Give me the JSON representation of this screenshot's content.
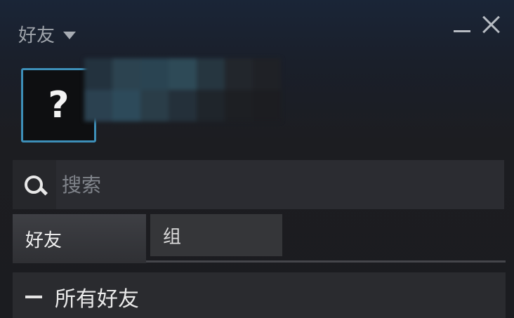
{
  "window": {
    "title": "好友",
    "controls": {
      "minimize": "minimize-icon",
      "close": "close-icon"
    }
  },
  "profile": {
    "avatar_glyph": "?"
  },
  "search": {
    "placeholder": "搜索",
    "value": ""
  },
  "tabs": [
    {
      "label": "好友",
      "active": true
    },
    {
      "label": "组",
      "active": false
    }
  ],
  "friends_list": {
    "group_label": "所有好友",
    "collapse_symbol": "minus-icon"
  },
  "colors": {
    "avatar_border": "#3d8fb8",
    "background": "#1b1c20"
  }
}
